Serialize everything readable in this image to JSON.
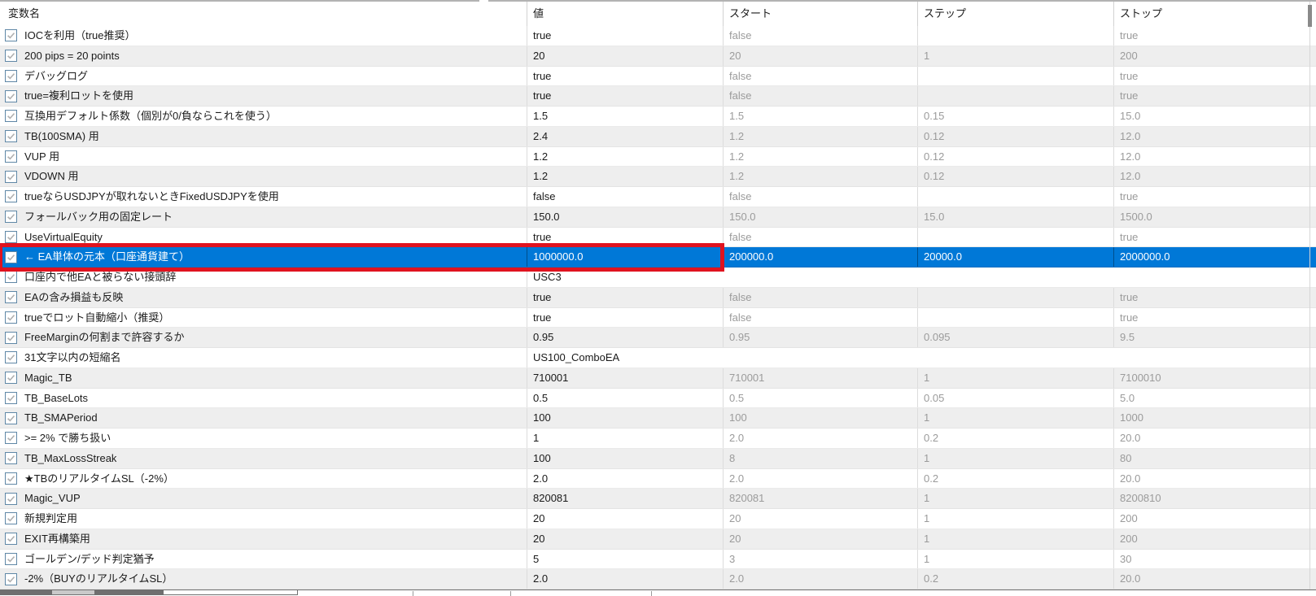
{
  "table": {
    "columns": [
      {
        "label": "変数名"
      },
      {
        "label": "値"
      },
      {
        "label": "スタート"
      },
      {
        "label": "ステップ"
      },
      {
        "label": "ストップ"
      }
    ],
    "rows": [
      {
        "label": "IOCを利用（true推奨）",
        "value": "true",
        "start": "false",
        "step": "",
        "stop": "true",
        "checked": true,
        "selected": false,
        "string_type": false
      },
      {
        "label": "200 pips = 20 points",
        "value": "20",
        "start": "20",
        "step": "1",
        "stop": "200",
        "checked": true,
        "selected": false,
        "string_type": false
      },
      {
        "label": "デバッグログ",
        "value": "true",
        "start": "false",
        "step": "",
        "stop": "true",
        "checked": true,
        "selected": false,
        "string_type": false
      },
      {
        "label": "true=複利ロットを使用",
        "value": "true",
        "start": "false",
        "step": "",
        "stop": "true",
        "checked": true,
        "selected": false,
        "string_type": false
      },
      {
        "label": "互換用デフォルト係数（個別が0/負ならこれを使う）",
        "value": "1.5",
        "start": "1.5",
        "step": "0.15",
        "stop": "15.0",
        "checked": true,
        "selected": false,
        "string_type": false
      },
      {
        "label": "TB(100SMA) 用",
        "value": "2.4",
        "start": "1.2",
        "step": "0.12",
        "stop": "12.0",
        "checked": true,
        "selected": false,
        "string_type": false
      },
      {
        "label": "VUP 用",
        "value": "1.2",
        "start": "1.2",
        "step": "0.12",
        "stop": "12.0",
        "checked": true,
        "selected": false,
        "string_type": false
      },
      {
        "label": "VDOWN 用",
        "value": "1.2",
        "start": "1.2",
        "step": "0.12",
        "stop": "12.0",
        "checked": true,
        "selected": false,
        "string_type": false
      },
      {
        "label": "trueならUSDJPYが取れないときFixedUSDJPYを使用",
        "value": "false",
        "start": "false",
        "step": "",
        "stop": "true",
        "checked": true,
        "selected": false,
        "string_type": false
      },
      {
        "label": "フォールバック用の固定レート",
        "value": "150.0",
        "start": "150.0",
        "step": "15.0",
        "stop": "1500.0",
        "checked": true,
        "selected": false,
        "string_type": false
      },
      {
        "label": "UseVirtualEquity",
        "value": "true",
        "start": "false",
        "step": "",
        "stop": "true",
        "checked": true,
        "selected": false,
        "string_type": false
      },
      {
        "label": "← EA単体の元本（口座通貨建て）",
        "value": "1000000.0",
        "start": "200000.0",
        "step": "20000.0",
        "stop": "2000000.0",
        "checked": true,
        "selected": true,
        "string_type": false
      },
      {
        "label": "口座内で他EAと被らない接頭辞",
        "value": "USC3",
        "start": "",
        "step": "",
        "stop": "",
        "checked": true,
        "selected": false,
        "string_type": true
      },
      {
        "label": "EAの含み損益も反映",
        "value": "true",
        "start": "false",
        "step": "",
        "stop": "true",
        "checked": true,
        "selected": false,
        "string_type": false
      },
      {
        "label": "trueでロット自動縮小（推奨）",
        "value": "true",
        "start": "false",
        "step": "",
        "stop": "true",
        "checked": true,
        "selected": false,
        "string_type": false
      },
      {
        "label": "FreeMarginの何割まで許容するか",
        "value": "0.95",
        "start": "0.95",
        "step": "0.095",
        "stop": "9.5",
        "checked": true,
        "selected": false,
        "string_type": false
      },
      {
        "label": "31文字以内の短縮名",
        "value": "US100_ComboEA",
        "start": "",
        "step": "",
        "stop": "",
        "checked": true,
        "selected": false,
        "string_type": true
      },
      {
        "label": "Magic_TB",
        "value": "710001",
        "start": "710001",
        "step": "1",
        "stop": "7100010",
        "checked": true,
        "selected": false,
        "string_type": false
      },
      {
        "label": "TB_BaseLots",
        "value": "0.5",
        "start": "0.5",
        "step": "0.05",
        "stop": "5.0",
        "checked": true,
        "selected": false,
        "string_type": false
      },
      {
        "label": "TB_SMAPeriod",
        "value": "100",
        "start": "100",
        "step": "1",
        "stop": "1000",
        "checked": true,
        "selected": false,
        "string_type": false
      },
      {
        "label": ">= 2% で勝ち扱い",
        "value": "1",
        "start": "2.0",
        "step": "0.2",
        "stop": "20.0",
        "checked": true,
        "selected": false,
        "string_type": false
      },
      {
        "label": "TB_MaxLossStreak",
        "value": "100",
        "start": "8",
        "step": "1",
        "stop": "80",
        "checked": true,
        "selected": false,
        "string_type": false
      },
      {
        "label": "★TBのリアルタイムSL（-2%）",
        "value": "2.0",
        "start": "2.0",
        "step": "0.2",
        "stop": "20.0",
        "checked": true,
        "selected": false,
        "string_type": false
      },
      {
        "label": "Magic_VUP",
        "value": "820081",
        "start": "820081",
        "step": "1",
        "stop": "8200810",
        "checked": true,
        "selected": false,
        "string_type": false
      },
      {
        "label": "新規判定用",
        "value": "20",
        "start": "20",
        "step": "1",
        "stop": "200",
        "checked": true,
        "selected": false,
        "string_type": false
      },
      {
        "label": "EXIT再構築用",
        "value": "20",
        "start": "20",
        "step": "1",
        "stop": "200",
        "checked": true,
        "selected": false,
        "string_type": false
      },
      {
        "label": "ゴールデン/デッド判定猶予",
        "value": "5",
        "start": "3",
        "step": "1",
        "stop": "30",
        "checked": true,
        "selected": false,
        "string_type": false
      },
      {
        "label": "-2%（BUYのリアルタイムSL）",
        "value": "2.0",
        "start": "2.0",
        "step": "0.2",
        "stop": "20.0",
        "checked": true,
        "selected": false,
        "string_type": false
      }
    ]
  },
  "selection": {
    "selected_row_label": "← EA単体の元本（口座通貨建て）",
    "highlight_color": "#0078d7"
  },
  "annotation": {
    "shape": "red-rectangle",
    "color": "#e0131f",
    "covers": "変数名と値の列（選択行）"
  },
  "colors": {
    "row_stripe": "#eeeeee",
    "grid_line": "#dcdcdc",
    "muted_text": "#9b9b9b",
    "checkbox_border": "#5f87a6",
    "checkmark": "#b0b0b0"
  }
}
